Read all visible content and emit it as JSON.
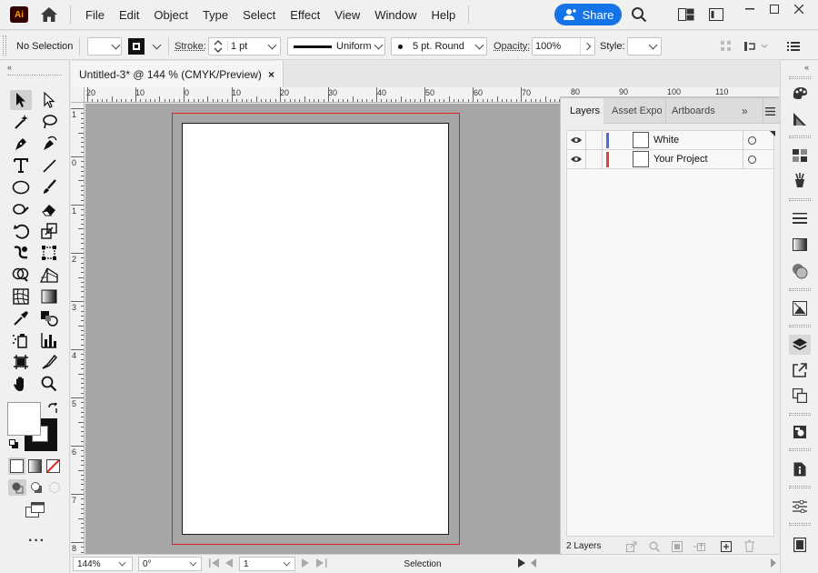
{
  "app": {
    "logo": "Ai",
    "accent": "#1473e6"
  },
  "menu": {
    "items": [
      "File",
      "Edit",
      "Object",
      "Type",
      "Select",
      "Effect",
      "View",
      "Window",
      "Help"
    ],
    "share_label": "Share"
  },
  "control_bar": {
    "selection_status": "No Selection",
    "stroke_label": "Stroke:",
    "stroke_value": "1 pt",
    "profile_label": "Uniform",
    "brush_label": "5 pt. Round",
    "opacity_label": "Opacity:",
    "opacity_value": "100%",
    "style_label": "Style:"
  },
  "document": {
    "tab_title": "Untitled-3* @ 144 % (CMYK/Preview)",
    "close_glyph": "×"
  },
  "rulers": {
    "horizontal": [
      "20",
      "10",
      "0",
      "10",
      "20",
      "30",
      "40",
      "50",
      "60",
      "70",
      "80",
      "90",
      "100",
      "110"
    ],
    "vertical": [
      "1",
      "0",
      "1",
      "2",
      "3",
      "4",
      "5",
      "6",
      "7",
      "8",
      "9"
    ]
  },
  "layers_panel": {
    "tabs": [
      "Layers",
      "Asset Expor",
      "Artboards"
    ],
    "active_tab": "Layers",
    "layers": [
      {
        "name": "White",
        "color": "#4a6fe0"
      },
      {
        "name": "Your Project",
        "color": "#e84040"
      }
    ],
    "count_label": "2 Layers"
  },
  "status_bar": {
    "zoom": "144%",
    "rotation": "0°",
    "artboard_number": "1",
    "tool_name": "Selection"
  },
  "colors": {
    "canvas": "#a6a6a6",
    "bleed": "#e0201d",
    "share": "#1473e6"
  }
}
